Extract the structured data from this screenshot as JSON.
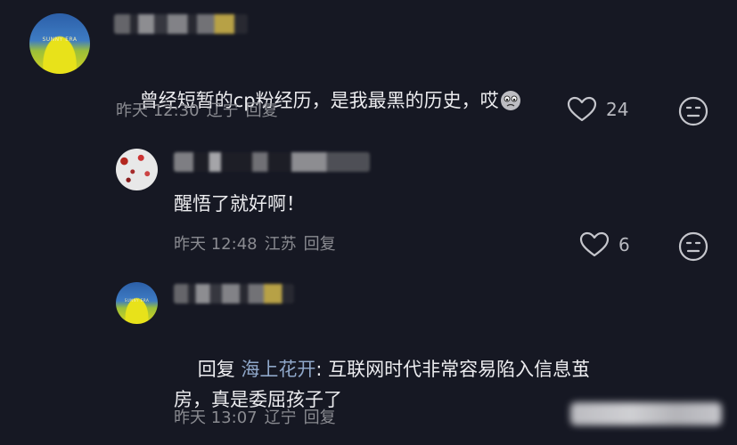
{
  "comments": [
    {
      "text": "曾经短暂的cp粉经历，是我最黑的历史，哎",
      "time": "昨天 12:30",
      "location": "辽宁",
      "reply_label": "回复",
      "likes": "24"
    },
    {
      "text": "醒悟了就好啊！",
      "time": "昨天 12:48",
      "location": "江苏",
      "reply_label": "回复",
      "likes": "6"
    },
    {
      "reply_prefix": "回复",
      "reply_to": "海上花开",
      "text_line1": ": 互联网时代非常容易陷入信息茧",
      "text_line2": "房，真是委屈孩子了",
      "time": "昨天 13:07",
      "location": "辽宁",
      "reply_label": "回复"
    }
  ],
  "icons": {
    "like": "heart-outline-icon",
    "dislike": "neutral-face-icon",
    "emoji": "sad-face-emoji"
  },
  "colors": {
    "background": "#161823",
    "text": "#ececef",
    "meta": "#8a8b91",
    "reply_target": "#8fa7c9"
  }
}
